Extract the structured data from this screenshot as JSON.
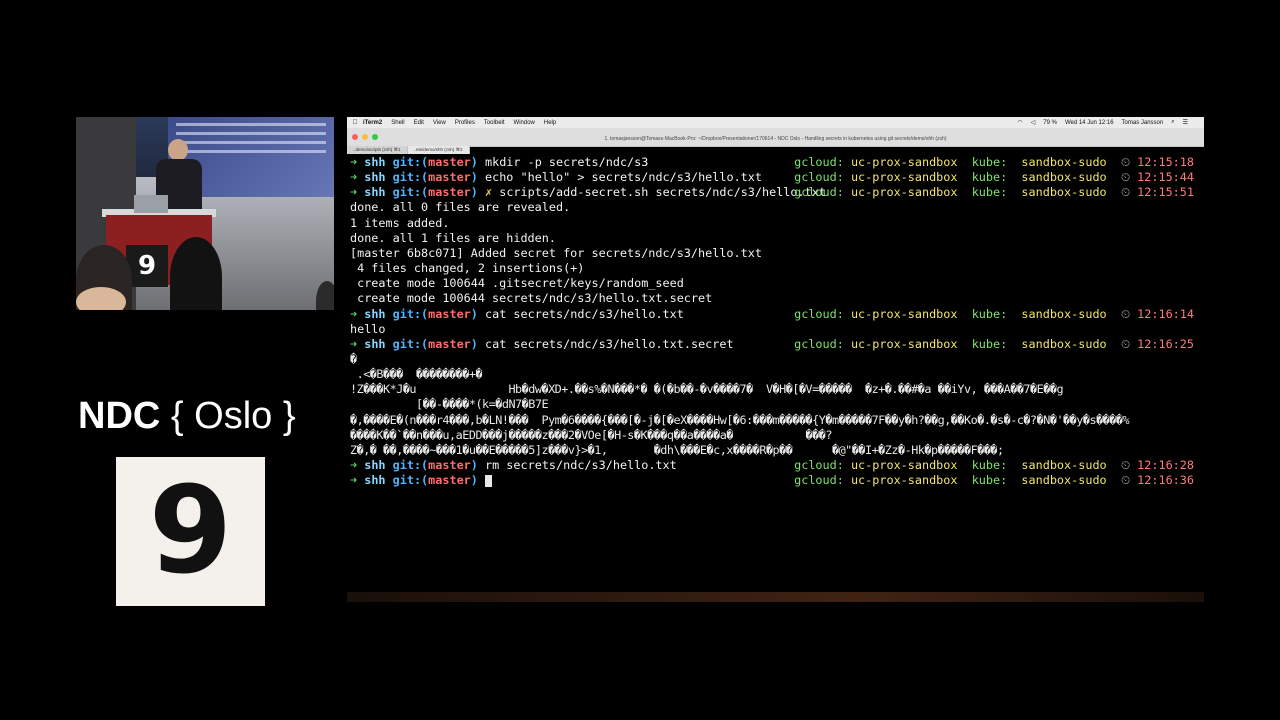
{
  "slide": {
    "logo_brand": "NDC",
    "logo_city": "{ Oslo }",
    "room_number": "9",
    "camera_room_number": "9"
  },
  "mac": {
    "menubar": {
      "app": "iTerm2",
      "items": [
        "Shell",
        "Edit",
        "View",
        "Profiles",
        "Toolbelt",
        "Window",
        "Help"
      ],
      "battery": "79 %",
      "datetime": "Wed 14 Jun  12:16",
      "user": "Tomas Jansson"
    },
    "window_title": "1. tomasjansson@Tomass-MacBook-Pro: ~/Dropbox/Presentationer/170614 - NDC Oslo - Handling secrets in kubernetes using git secrets/demo/shh (zsh)",
    "tabs": [
      {
        "label": "..demo/scripts (zsh)  ⌘1"
      },
      {
        "label": "..ets/demo/shh (zsh)  ⌘2"
      }
    ]
  },
  "terminal": {
    "prompt": {
      "arrow": "➜",
      "dir": "shh",
      "git_prefix": "git:(",
      "branch": "master",
      "git_suffix": ")",
      "gcloud_label": "gcloud:",
      "gcloud_value": "uc-prox-sandbox",
      "kube_label": "kube:",
      "kube_value": "sandbox-sudo",
      "clock_icon": "⏲"
    },
    "lines": [
      {
        "cmd": "mkdir -p secrets/ndc/s3",
        "time": "12:15:18"
      },
      {
        "cmd": "echo \"hello\" > secrets/ndc/s3/hello.txt",
        "time": "12:15:44"
      },
      {
        "x": "✗",
        "cmd": "scripts/add-secret.sh secrets/ndc/s3/hello.txt",
        "time": "12:15:51"
      },
      {
        "output": "done. all 0 files are revealed."
      },
      {
        "output": "1 items added."
      },
      {
        "output": "done. all 1 files are hidden."
      },
      {
        "output": "[master 6b8c071] Added secret for secrets/ndc/s3/hello.txt"
      },
      {
        "output": " 4 files changed, 2 insertions(+)"
      },
      {
        "output": " create mode 100644 .gitsecret/keys/random_seed"
      },
      {
        "output": " create mode 100644 secrets/ndc/s3/hello.txt.secret"
      },
      {
        "cmd": "cat secrets/ndc/s3/hello.txt",
        "time": "12:16:14"
      },
      {
        "output": "hello"
      },
      {
        "cmd": "cat secrets/ndc/s3/hello.txt.secret",
        "time": "12:16:25"
      },
      {
        "output": "�"
      },
      {
        "output": " .<�B���  ��������+�"
      },
      {
        "output": "!Z���K*J�u              Hb�dw�XD+.��s%�N���*� �(�b��-�v����7�  V�H�[�V=�����  �z+�.��#�a ��iYv, ���A��7�E��g"
      },
      {
        "output": "          [��-����*(k=�dN7�B7E"
      },
      {
        "output": "�,����E�(n���r4���,b�LN!���  Pym�6����{���[�-j�[�eX����Hw[�6:���m�����{Y�m�����7F��y�h?��g,��Ko�.�s�-c�?�N�'��y�s����%"
      },
      {
        "output": "����K��`��n���u,aEDD���j�����z���2�VOe[�H-s�K���q��a����a�           ���?"
      },
      {
        "output": "Z�,� ��,����~���1�u��E�����5]z���v}>�1,       �dh\\���E�c,x����R�p��      �@\"��I+�Zz�-Hk�p�����F���;"
      },
      {
        "cmd": "rm secrets/ndc/s3/hello.txt",
        "time": "12:16:28"
      },
      {
        "cmd": "",
        "time": "12:16:36",
        "cursor": true
      }
    ]
  }
}
